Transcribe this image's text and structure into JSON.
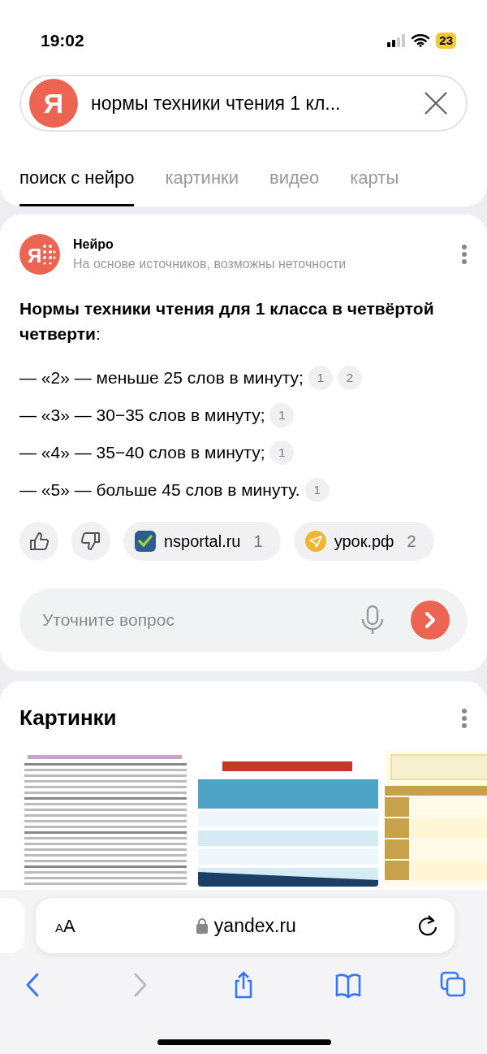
{
  "status_bar": {
    "time": "19:02",
    "battery": "23"
  },
  "search": {
    "logo": "Я",
    "query": "нормы техники чтения 1 кл..."
  },
  "tabs": [
    {
      "label": "поиск с нейро",
      "selected": true
    },
    {
      "label": "картинки",
      "selected": false
    },
    {
      "label": "видео",
      "selected": false
    },
    {
      "label": "карты",
      "selected": false
    }
  ],
  "neuro": {
    "logo": "Я",
    "name": "Нейро",
    "subtitle": "На основе источников, возможны неточности",
    "heading": "**Нормы техники чтения для 1 класса в четвёртой четверти**:",
    "items": [
      {
        "text": "— «2» — меньше 25 слов в минуту;",
        "citations": [
          "1",
          "2"
        ]
      },
      {
        "text": "— «3» — 30−35 слов в минуту;",
        "citations": [
          "1"
        ]
      },
      {
        "text": "— «4» — 35−40 слов в минуту;",
        "citations": [
          "1"
        ]
      },
      {
        "text": "— «5» — больше 45 слов в минуту.",
        "citations": [
          "1"
        ]
      }
    ],
    "sources": [
      {
        "kind": "check",
        "name": "nsportal.ru",
        "count": "1"
      },
      {
        "kind": "plane",
        "name": "урок.рф",
        "count": "2"
      }
    ],
    "followup": {
      "placeholder": "Уточните вопрос"
    }
  },
  "images": {
    "title": "Картинки"
  },
  "browser": {
    "text_size": "AA",
    "url": "yandex.ru",
    "toolbar": [
      {
        "kind": "back",
        "disabled": false
      },
      {
        "kind": "forward",
        "disabled": true
      },
      {
        "kind": "share",
        "disabled": false
      },
      {
        "kind": "bookmarks",
        "disabled": false
      },
      {
        "kind": "tabs",
        "disabled": false
      }
    ]
  }
}
